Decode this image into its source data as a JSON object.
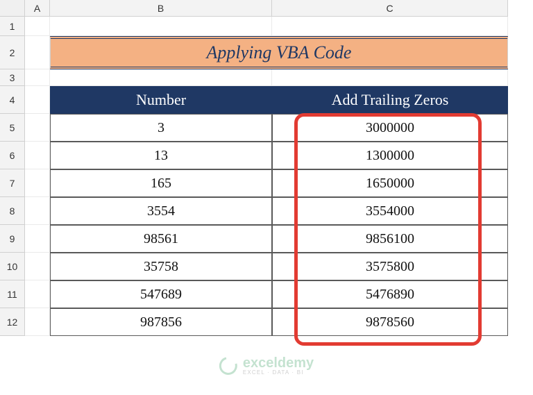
{
  "columns": [
    "A",
    "B",
    "C"
  ],
  "rows": [
    "1",
    "2",
    "3",
    "4",
    "5",
    "6",
    "7",
    "8",
    "9",
    "10",
    "11",
    "12"
  ],
  "title": "Applying VBA Code",
  "headers": {
    "number": "Number",
    "trailing": "Add Trailing Zeros"
  },
  "data": [
    {
      "number": "3",
      "trailing": "3000000"
    },
    {
      "number": "13",
      "trailing": "1300000"
    },
    {
      "number": "165",
      "trailing": "1650000"
    },
    {
      "number": "3554",
      "trailing": "3554000"
    },
    {
      "number": "98561",
      "trailing": "9856100"
    },
    {
      "number": "35758",
      "trailing": "3575800"
    },
    {
      "number": "547689",
      "trailing": "5476890"
    },
    {
      "number": "987856",
      "trailing": "9878560"
    }
  ],
  "watermark": {
    "brand": "exceldemy",
    "tag": "EXCEL · DATA · BI"
  },
  "chart_data": {
    "type": "table",
    "title": "Applying VBA Code",
    "columns": [
      "Number",
      "Add Trailing Zeros"
    ],
    "rows": [
      [
        "3",
        "3000000"
      ],
      [
        "13",
        "1300000"
      ],
      [
        "165",
        "1650000"
      ],
      [
        "3554",
        "3554000"
      ],
      [
        "98561",
        "9856100"
      ],
      [
        "35758",
        "3575800"
      ],
      [
        "547689",
        "5476890"
      ],
      [
        "987856",
        "9878560"
      ]
    ]
  }
}
